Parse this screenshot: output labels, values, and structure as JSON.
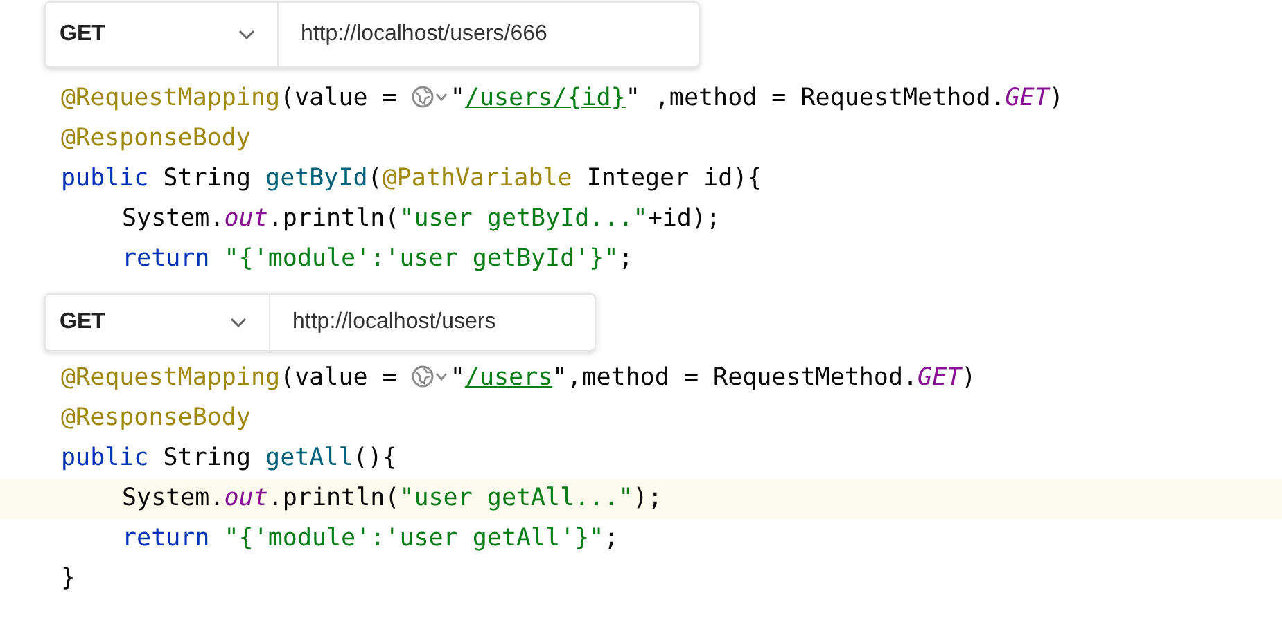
{
  "blocks": [
    {
      "request": {
        "method": "GET",
        "url": "http://localhost/users/666"
      },
      "lines": [
        {
          "indented": false,
          "highlighted": false,
          "tokens": [
            {
              "kind": "annotation",
              "text": "@RequestMapping"
            },
            {
              "kind": "plain",
              "text": "(value = "
            },
            {
              "kind": "globe"
            },
            {
              "kind": "plain",
              "text": "\""
            },
            {
              "kind": "link",
              "text": "/users/{id}"
            },
            {
              "kind": "plain",
              "text": "\" ,method = RequestMethod."
            },
            {
              "kind": "constant",
              "text": "GET"
            },
            {
              "kind": "plain",
              "text": ")"
            }
          ]
        },
        {
          "indented": false,
          "highlighted": false,
          "tokens": [
            {
              "kind": "annotation",
              "text": "@ResponseBody"
            }
          ]
        },
        {
          "indented": false,
          "highlighted": false,
          "tokens": [
            {
              "kind": "keyword",
              "text": "public "
            },
            {
              "kind": "plain",
              "text": "String "
            },
            {
              "kind": "method",
              "text": "getById"
            },
            {
              "kind": "plain",
              "text": "("
            },
            {
              "kind": "annotation",
              "text": "@PathVariable "
            },
            {
              "kind": "plain",
              "text": "Integer id){"
            }
          ]
        },
        {
          "indented": true,
          "highlighted": false,
          "tokens": [
            {
              "kind": "plain",
              "text": "System."
            },
            {
              "kind": "constant",
              "text": "out"
            },
            {
              "kind": "plain",
              "text": ".println("
            },
            {
              "kind": "string",
              "text": "\"user getById...\""
            },
            {
              "kind": "plain",
              "text": "+id);"
            }
          ]
        },
        {
          "indented": true,
          "highlighted": false,
          "tokens": [
            {
              "kind": "keyword",
              "text": "return "
            },
            {
              "kind": "string",
              "text": "\"{'module':'user getById'}\""
            },
            {
              "kind": "plain",
              "text": ";"
            }
          ]
        }
      ]
    },
    {
      "request": {
        "method": "GET",
        "url": "http://localhost/users"
      },
      "lines": [
        {
          "indented": false,
          "highlighted": false,
          "tokens": [
            {
              "kind": "annotation",
              "text": "@RequestMapping"
            },
            {
              "kind": "plain",
              "text": "(value = "
            },
            {
              "kind": "globe"
            },
            {
              "kind": "plain",
              "text": "\""
            },
            {
              "kind": "link",
              "text": "/users"
            },
            {
              "kind": "plain",
              "text": "\",method = RequestMethod."
            },
            {
              "kind": "constant",
              "text": "GET"
            },
            {
              "kind": "plain",
              "text": ")"
            }
          ]
        },
        {
          "indented": false,
          "highlighted": false,
          "tokens": [
            {
              "kind": "annotation",
              "text": "@ResponseBody"
            }
          ]
        },
        {
          "indented": false,
          "highlighted": false,
          "tokens": [
            {
              "kind": "keyword",
              "text": "public "
            },
            {
              "kind": "plain",
              "text": "String "
            },
            {
              "kind": "method",
              "text": "getAll"
            },
            {
              "kind": "plain",
              "text": "(){"
            }
          ]
        },
        {
          "indented": true,
          "highlighted": true,
          "tokens": [
            {
              "kind": "plain",
              "text": "System."
            },
            {
              "kind": "constant",
              "text": "out"
            },
            {
              "kind": "plain",
              "text": ".println("
            },
            {
              "kind": "string",
              "text": "\"user getAll...\""
            },
            {
              "kind": "plain",
              "text": ");"
            }
          ]
        },
        {
          "indented": true,
          "highlighted": false,
          "tokens": [
            {
              "kind": "keyword",
              "text": "return "
            },
            {
              "kind": "string",
              "text": "\"{'module':'user getAll'}\""
            },
            {
              "kind": "plain",
              "text": ";"
            }
          ]
        },
        {
          "indented": false,
          "highlighted": false,
          "tokens": [
            {
              "kind": "plain",
              "text": "}"
            }
          ]
        }
      ]
    }
  ]
}
